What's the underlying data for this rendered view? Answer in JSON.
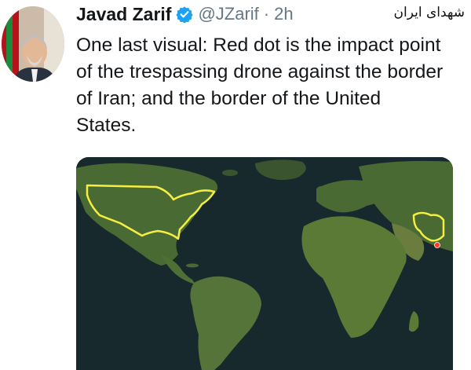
{
  "tweet": {
    "author_name": "Javad Zarif",
    "verified_icon": "verified-badge-icon",
    "handle": "@JZarif",
    "separator": "·",
    "time": "2h",
    "text": "One last visual: Red dot is the impact point of the trespassing drone against the border of Iran; and the border of the United States."
  },
  "watermark": {
    "text": "شهدای ایران"
  },
  "colors": {
    "verified_blue": "#1da1f2",
    "ocean": "#18292e",
    "land": "#4a6a33",
    "border_outline": "#f5ee42",
    "impact_dot": "#ff3b30"
  },
  "media": {
    "alt": "world-map",
    "impact_marker": "red-dot"
  }
}
